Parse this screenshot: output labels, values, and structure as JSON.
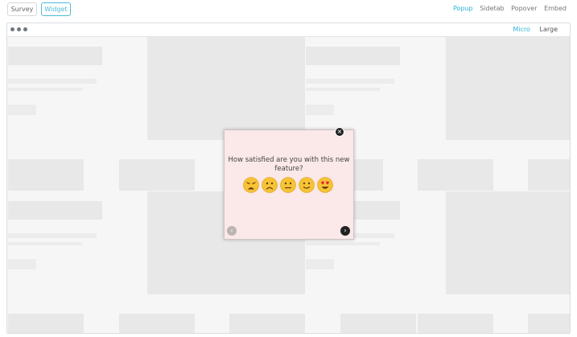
{
  "topbar": {
    "tabs": [
      {
        "label": "Survey",
        "active": false
      },
      {
        "label": "Widget",
        "active": true
      }
    ],
    "modes": [
      {
        "label": "Popup",
        "active": true
      },
      {
        "label": "Sidetab",
        "active": false
      },
      {
        "label": "Popover",
        "active": false
      },
      {
        "label": "Embed",
        "active": false
      }
    ]
  },
  "preview": {
    "sizes": [
      {
        "label": "Micro",
        "active": true
      },
      {
        "label": "Large",
        "active": false
      }
    ]
  },
  "popup": {
    "question": "How satisfied are you with this new feature?",
    "emojis": [
      "very-dissatisfied",
      "dissatisfied",
      "neutral",
      "satisfied",
      "very-satisfied"
    ],
    "close_symbol": "×",
    "prev_symbol": "‹",
    "next_symbol": "›"
  },
  "colors": {
    "accent": "#2db4d6",
    "popup_bg": "#fbe8e8",
    "emoji_face": "#f6c335",
    "emoji_heart": "#e0283c"
  }
}
